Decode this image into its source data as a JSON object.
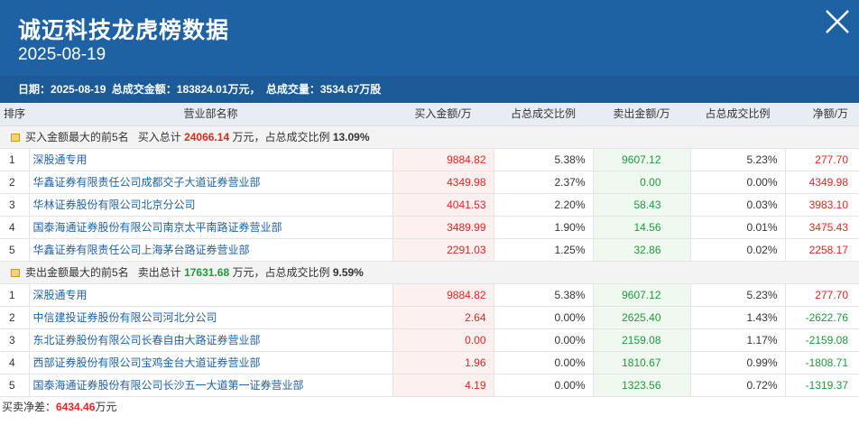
{
  "header": {
    "title": "诚迈科技龙虎榜数据",
    "date": "2025-08-19",
    "info_date_label": "日期：",
    "info_date": "2025-08-19",
    "info_amount_label": "总成交金额：",
    "info_amount": "183824.01万元，",
    "info_volume_label": "总成交量：",
    "info_volume": "3534.67万股"
  },
  "columns": {
    "idx": "排序",
    "name": "营业部名称",
    "buy": "买入金额/万",
    "buy_pct": "占总成交比例",
    "sell": "卖出金额/万",
    "sell_pct": "占总成交比例",
    "net": "净额/万"
  },
  "buy_section": {
    "label": "买入金额最大的前5名",
    "total_label": "买入总计",
    "total": "24066.14",
    "unit": "万元，占总成交比例",
    "pct": "13.09%",
    "rows": [
      {
        "idx": "1",
        "name": "深股通专用",
        "buy": "9884.82",
        "buy_pct": "5.38%",
        "sell": "9607.12",
        "sell_pct": "5.23%",
        "net": "277.70"
      },
      {
        "idx": "2",
        "name": "华鑫证券有限责任公司成都交子大道证券营业部",
        "buy": "4349.98",
        "buy_pct": "2.37%",
        "sell": "0.00",
        "sell_pct": "0.00%",
        "net": "4349.98"
      },
      {
        "idx": "3",
        "name": "华林证券股份有限公司北京分公司",
        "buy": "4041.53",
        "buy_pct": "2.20%",
        "sell": "58.43",
        "sell_pct": "0.03%",
        "net": "3983.10"
      },
      {
        "idx": "4",
        "name": "国泰海通证券股份有限公司南京太平南路证券营业部",
        "buy": "3489.99",
        "buy_pct": "1.90%",
        "sell": "14.56",
        "sell_pct": "0.01%",
        "net": "3475.43"
      },
      {
        "idx": "5",
        "name": "华鑫证券有限责任公司上海茅台路证券营业部",
        "buy": "2291.03",
        "buy_pct": "1.25%",
        "sell": "32.86",
        "sell_pct": "0.02%",
        "net": "2258.17"
      }
    ]
  },
  "sell_section": {
    "label": "卖出金额最大的前5名",
    "total_label": "卖出总计",
    "total": "17631.68",
    "unit": "万元，占总成交比例",
    "pct": "9.59%",
    "rows": [
      {
        "idx": "1",
        "name": "深股通专用",
        "buy": "9884.82",
        "buy_pct": "5.38%",
        "sell": "9607.12",
        "sell_pct": "5.23%",
        "net": "277.70"
      },
      {
        "idx": "2",
        "name": "中信建投证券股份有限公司河北分公司",
        "buy": "2.64",
        "buy_pct": "0.00%",
        "sell": "2625.40",
        "sell_pct": "1.43%",
        "net": "-2622.76"
      },
      {
        "idx": "3",
        "name": "东北证券股份有限公司长春自由大路证券营业部",
        "buy": "0.00",
        "buy_pct": "0.00%",
        "sell": "2159.08",
        "sell_pct": "1.17%",
        "net": "-2159.08"
      },
      {
        "idx": "4",
        "name": "西部证券股份有限公司宝鸡金台大道证券营业部",
        "buy": "1.96",
        "buy_pct": "0.00%",
        "sell": "1810.67",
        "sell_pct": "0.99%",
        "net": "-1808.71"
      },
      {
        "idx": "5",
        "name": "国泰海通证券股份有限公司长沙五一大道第一证券营业部",
        "buy": "4.19",
        "buy_pct": "0.00%",
        "sell": "1323.56",
        "sell_pct": "0.72%",
        "net": "-1319.37"
      }
    ]
  },
  "footer": {
    "label": "买卖净差：",
    "value": "6434.46",
    "unit": "万元"
  },
  "colors": {
    "header_bg": "#1f62a4",
    "buy": "#e0271f",
    "sell": "#1d9a3c",
    "link": "#1f62a4"
  },
  "icons": {
    "close": "close-icon",
    "section": "folder-icon"
  }
}
